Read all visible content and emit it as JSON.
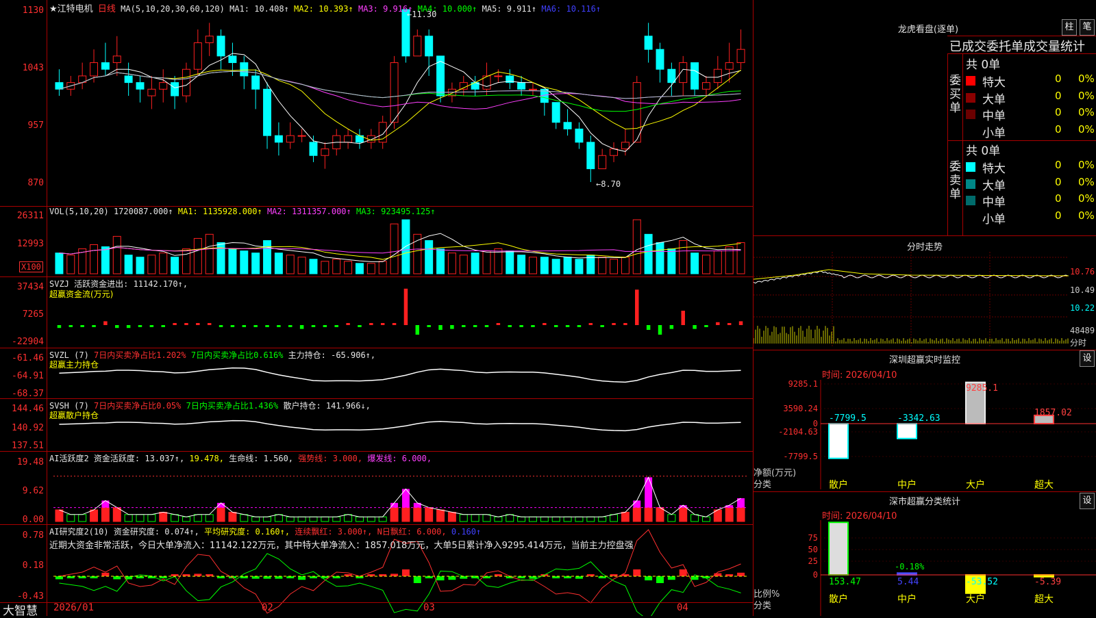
{
  "stock": {
    "star_name": "★江特电机",
    "period": "日线"
  },
  "colors": {
    "up": "#ff2020",
    "down": "#00ffff",
    "ma5": "#ffffff",
    "ma10": "#ffff00",
    "ma20": "#ff40ff",
    "ma30": "#00ff00",
    "ma60": "#4040ff",
    "ma120": "#c0c0c0"
  },
  "price_pane": {
    "ma_header": "MA(5,10,20,30,60,120)",
    "ma1": "MA1: 10.408↑",
    "ma2": "MA2: 10.393↑",
    "ma3": "MA3: 9.916↑",
    "ma4": "MA4: 10.000↑",
    "ma5": "MA5: 9.911↑",
    "ma6": "MA6: 10.116↑",
    "y_ticks": [
      "1130",
      "1043",
      "957",
      "870"
    ],
    "high_label": "←11.30",
    "low_label": "←8.70"
  },
  "vol_pane": {
    "header": "VOL(5,10,20)",
    "value": "1720087.000↑",
    "ma1": "MA1: 1135928.000↑",
    "ma2": "MA2: 1311357.000↑",
    "ma3": "MA3: 923495.125↑",
    "y_ticks": [
      "26311",
      "12993"
    ],
    "unit": "X100"
  },
  "svzj_pane": {
    "header": "SVZJ  活跃资金进出: 11142.170↑,",
    "sub": "超赢资金流(万元)",
    "y_ticks": [
      "37434",
      "7265",
      "-22904"
    ]
  },
  "svzl_pane": {
    "header_a": "SVZL (7)",
    "header_b": "7日内买卖净占比1.202%",
    "header_c": "7日内买卖净占比0.616%",
    "header_d": "主力持仓: -65.906↑,",
    "sub": "超赢主力持仓",
    "y_ticks": [
      "-61.46",
      "-64.91",
      "-68.37"
    ]
  },
  "svsh_pane": {
    "header_a": "SVSH (7)",
    "header_b": "7日内买卖净占比0.05%",
    "header_c": "7日内买卖净占比1.436%",
    "header_d": "散户持仓: 141.966↓,",
    "sub": "超赢散户持仓",
    "y_ticks": [
      "144.46",
      "140.92",
      "137.51"
    ]
  },
  "ai_active_pane": {
    "header_a": "AI活跃度2",
    "header_b": "资金活跃度: 13.037↑,",
    "header_c": "19.478,",
    "header_d": "生命线: 1.560,",
    "header_e": "强势线: 3.000,",
    "header_f": "爆发线: 6.000,",
    "y_ticks": [
      "19.48",
      "9.62",
      "0.00"
    ]
  },
  "ai_research_pane": {
    "header_a": "AI研究度2(10)",
    "header_b": "资金研究度: 0.074↑,",
    "header_c": "平均研究度: 0.160↑,",
    "header_d": "连续飘红: 3.000↑,",
    "header_e": "N日飘红: 6.000,",
    "header_f": "0.160↑",
    "comment": "近期大资金非常活跃，今日大单净流入：11142.122万元，其中特大单净流入：1857.018万元，大单5日累计净入9295.414万元，当前主力控盘强",
    "y_ticks": [
      "0.78",
      "0.18",
      "-0.43"
    ]
  },
  "x_dates": [
    "2026/01",
    "02",
    "03",
    "04"
  ],
  "brand": "大智慧",
  "right_panel": {
    "lhb_title": "龙虎看盘(逐单)",
    "btn_col": "柱",
    "btn_pen": "笔",
    "stats_title": "已成交委托单成交量统计",
    "buy_side": {
      "label": "委买单",
      "total": "共 0单",
      "rows": [
        {
          "name": "特大",
          "v": "0",
          "p": "0%",
          "color": "#ff0000"
        },
        {
          "name": "大单",
          "v": "0",
          "p": "0%",
          "color": "#8b0000"
        },
        {
          "name": "中单",
          "v": "0",
          "p": "0%",
          "color": "#6b0000"
        },
        {
          "name": "小单",
          "v": "0",
          "p": "0%",
          "color": "#000000"
        }
      ]
    },
    "sell_side": {
      "label": "委卖单",
      "total": "共 0单",
      "rows": [
        {
          "name": "特大",
          "v": "0",
          "p": "0%",
          "color": "#00ffff"
        },
        {
          "name": "大单",
          "v": "0",
          "p": "0%",
          "color": "#008888"
        },
        {
          "name": "中单",
          "v": "0",
          "p": "0%",
          "color": "#006b6b"
        },
        {
          "name": "小单",
          "v": "0",
          "p": "0%",
          "color": "#000000"
        }
      ]
    },
    "intraday_title": "分时走势",
    "intraday_ticks": [
      "10.76",
      "10.49",
      "10.22",
      "48489"
    ],
    "intraday_foot": "分时",
    "sz_monitor": {
      "title": "深圳超赢实时监控",
      "btn": "设",
      "time": "时间: 2026/04/10",
      "y_ticks": [
        "9285.1",
        "3590.24",
        "0",
        "-2104.63",
        "-7799.5"
      ],
      "ylabel": "净额(万元)",
      "xlabel": "分类",
      "cats": [
        "散户",
        "中户",
        "大户",
        "超大"
      ],
      "values": [
        -7799.5,
        -3342.63,
        9285.1,
        1857.02
      ],
      "value_labels": [
        "-7799.5",
        "-3342.63",
        "9285.1",
        "1857.02"
      ]
    },
    "sz_class": {
      "title": "深市超赢分类统计",
      "btn": "设",
      "time": "时间: 2026/04/10",
      "y_ticks": [
        "75",
        "50",
        "25",
        "0"
      ],
      "ylabel": "比例%",
      "xlabel": "分类",
      "cats": [
        "散户",
        "中户",
        "大户",
        "超大"
      ],
      "values": [
        153.47,
        5.44,
        -53.52,
        -5.39
      ],
      "value_labels": [
        "153.47",
        "5.44",
        "-53.52",
        "-5.39"
      ],
      "extra_label": "-0.18%"
    }
  },
  "chart_data": [
    {
      "type": "candlestick",
      "title": "",
      "series": [
        {
          "name": "price",
          "values": [
            [
              10.2,
              10.1,
              10.4,
              10.0
            ],
            [
              10.1,
              10.2,
              10.3,
              10.0
            ],
            [
              10.2,
              10.3,
              10.5,
              10.1
            ],
            [
              10.3,
              10.5,
              10.7,
              10.2
            ],
            [
              10.5,
              10.4,
              10.8,
              10.3
            ],
            [
              10.5,
              10.6,
              10.9,
              10.3
            ],
            [
              10.3,
              10.2,
              10.5,
              10.0
            ],
            [
              10.2,
              10.1,
              10.3,
              9.9
            ],
            [
              10.0,
              10.1,
              10.3,
              9.8
            ],
            [
              10.1,
              10.2,
              10.4,
              9.9
            ],
            [
              10.2,
              10.0,
              10.3,
              9.8
            ],
            [
              10.0,
              10.4,
              10.5,
              9.9
            ],
            [
              10.4,
              10.8,
              11.0,
              10.3
            ],
            [
              10.8,
              10.9,
              11.1,
              10.6
            ],
            [
              10.9,
              10.6,
              11.0,
              10.4
            ],
            [
              10.6,
              10.5,
              10.8,
              10.3
            ],
            [
              10.5,
              10.3,
              10.6,
              10.1
            ],
            [
              10.3,
              10.1,
              10.4,
              9.8
            ],
            [
              10.1,
              9.4,
              10.2,
              9.2
            ],
            [
              9.4,
              9.3,
              9.6,
              9.1
            ],
            [
              9.3,
              9.4,
              9.6,
              9.2
            ],
            [
              9.4,
              9.4,
              9.5,
              9.3
            ],
            [
              9.3,
              9.1,
              9.4,
              9.0
            ],
            [
              9.1,
              9.2,
              9.3,
              8.9
            ],
            [
              9.2,
              9.4,
              9.5,
              9.1
            ],
            [
              9.3,
              9.4,
              9.5,
              9.2
            ],
            [
              9.4,
              9.3,
              9.5,
              9.2
            ],
            [
              9.3,
              9.4,
              9.5,
              9.2
            ],
            [
              9.3,
              9.6,
              9.7,
              9.2
            ],
            [
              9.6,
              10.5,
              10.6,
              9.5
            ],
            [
              11.3,
              10.6,
              11.3,
              10.5
            ],
            [
              10.6,
              10.9,
              11.0,
              10.6
            ],
            [
              10.9,
              10.6,
              11.0,
              10.3
            ],
            [
              10.6,
              10.0,
              10.6,
              9.9
            ],
            [
              10.0,
              10.1,
              10.2,
              9.9
            ],
            [
              10.1,
              10.2,
              10.3,
              10.0
            ],
            [
              10.2,
              10.1,
              10.3,
              10.0
            ],
            [
              10.1,
              10.3,
              10.5,
              10.0
            ],
            [
              10.3,
              10.3,
              10.4,
              10.2
            ],
            [
              10.3,
              10.2,
              10.4,
              10.1
            ],
            [
              10.2,
              10.1,
              10.3,
              10.0
            ],
            [
              10.1,
              10.1,
              10.2,
              10.0
            ],
            [
              10.1,
              9.9,
              10.1,
              9.7
            ],
            [
              9.9,
              9.6,
              9.9,
              9.5
            ],
            [
              9.6,
              9.5,
              9.8,
              9.4
            ],
            [
              9.5,
              9.3,
              9.6,
              9.2
            ],
            [
              9.3,
              8.9,
              9.4,
              8.7
            ],
            [
              8.9,
              9.1,
              9.2,
              8.9
            ],
            [
              9.1,
              9.2,
              9.3,
              9.0
            ],
            [
              9.2,
              9.3,
              9.5,
              9.1
            ],
            [
              9.3,
              10.2,
              10.3,
              9.3
            ],
            [
              10.9,
              10.7,
              11.1,
              10.5
            ],
            [
              10.7,
              10.4,
              10.8,
              10.2
            ],
            [
              10.4,
              10.2,
              10.5,
              10.0
            ],
            [
              10.2,
              10.5,
              10.6,
              10.0
            ],
            [
              10.5,
              10.1,
              10.5,
              10.0
            ],
            [
              10.1,
              10.2,
              10.3,
              10.0
            ],
            [
              10.2,
              10.4,
              10.6,
              10.1
            ],
            [
              10.4,
              10.5,
              10.8,
              10.2
            ],
            [
              10.5,
              10.7,
              11.0,
              10.4
            ]
          ]
        }
      ]
    },
    {
      "type": "bar",
      "series": [
        {
          "name": "VOL",
          "values": [
            10,
            9,
            12,
            14,
            13,
            18,
            9,
            8,
            9,
            10,
            8,
            12,
            17,
            19,
            15,
            12,
            11,
            10,
            16,
            10,
            9,
            8,
            7,
            6,
            7,
            6,
            5,
            5,
            6,
            24,
            26,
            19,
            16,
            12,
            10,
            9,
            10,
            11,
            12,
            11,
            9,
            8,
            8,
            7,
            8,
            7,
            9,
            8,
            7,
            8,
            26,
            19,
            15,
            12,
            16,
            10,
            9,
            11,
            13,
            15
          ]
        }
      ]
    },
    {
      "type": "bar",
      "series": [
        {
          "name": "SVZJ",
          "values": [
            -3,
            -1,
            -1,
            -1,
            4,
            -3,
            -3,
            -1,
            -1,
            -1,
            1,
            1,
            2,
            1,
            -1,
            -1,
            -1,
            -2,
            -2,
            -2,
            -1,
            -4,
            -1,
            -1,
            -1,
            1,
            -1,
            1,
            1,
            2,
            38,
            -10,
            -1,
            -5,
            -4,
            -2,
            -1,
            -1,
            1,
            -1,
            -1,
            -2,
            1,
            -1,
            -1,
            -2,
            1,
            -1,
            1,
            1,
            37,
            -5,
            -10,
            -4,
            15,
            -4,
            -1,
            3,
            1,
            4
          ]
        }
      ]
    },
    {
      "type": "bar",
      "series": [
        {
          "name": "AI活跃度",
          "values": [
            5,
            3,
            3,
            5,
            9,
            6,
            3,
            3,
            3,
            4,
            3,
            2,
            3,
            3,
            8,
            4,
            3,
            2,
            2,
            3,
            2,
            2,
            2,
            2,
            2,
            3,
            2,
            2,
            2,
            8,
            14,
            8,
            6,
            5,
            4,
            3,
            3,
            3,
            2,
            3,
            2,
            2,
            2,
            2,
            2,
            2,
            2,
            2,
            3,
            4,
            9,
            19,
            6,
            3,
            7,
            3,
            2,
            5,
            7,
            10
          ]
        }
      ]
    }
  ]
}
